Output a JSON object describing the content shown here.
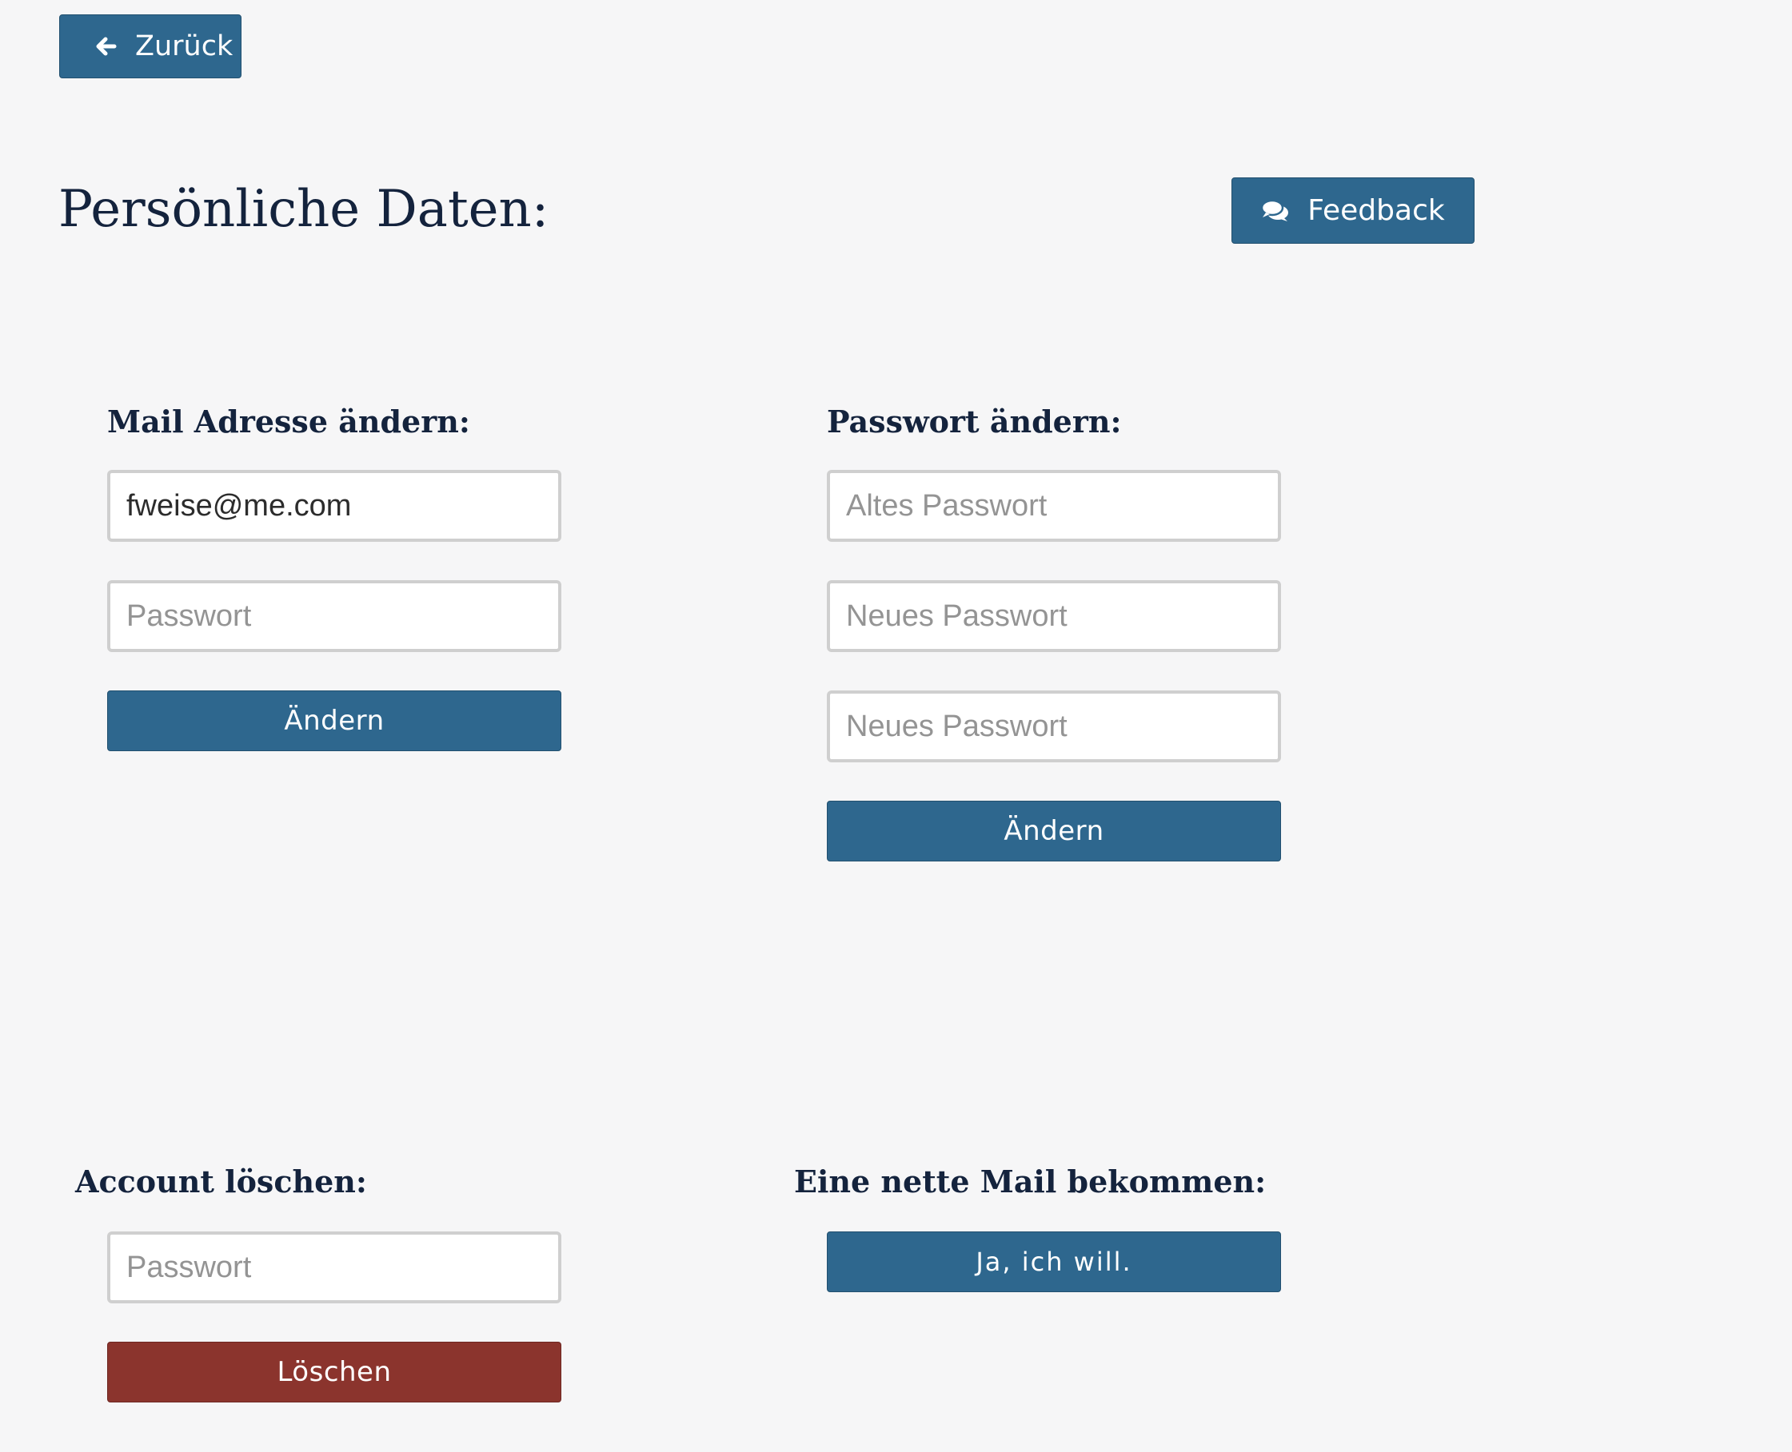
{
  "nav": {
    "back_label": "Zurück"
  },
  "header": {
    "title": "Persönliche Daten:",
    "feedback_label": "Feedback"
  },
  "mail_section": {
    "title": "Mail Adresse ändern:",
    "email_value": "fweise@me.com",
    "password_placeholder": "Passwort",
    "submit_label": "Ändern"
  },
  "password_section": {
    "title": "Passwort ändern:",
    "old_placeholder": "Altes Passwort",
    "new_placeholder": "Neues Passwort",
    "repeat_placeholder": "Neues Passwort",
    "submit_label": "Ändern"
  },
  "delete_section": {
    "title": "Account löschen:",
    "password_placeholder": "Passwort",
    "submit_label": "Löschen"
  },
  "newsletter_section": {
    "title": "Eine nette Mail bekommen:",
    "submit_label": "Ja, ich will."
  },
  "colors": {
    "primary": "#2e678e",
    "danger": "#8b342d",
    "background": "#f6f6f7",
    "heading": "#14233d"
  },
  "icons": {
    "back": "arrow-left-icon",
    "feedback": "comments-icon"
  }
}
